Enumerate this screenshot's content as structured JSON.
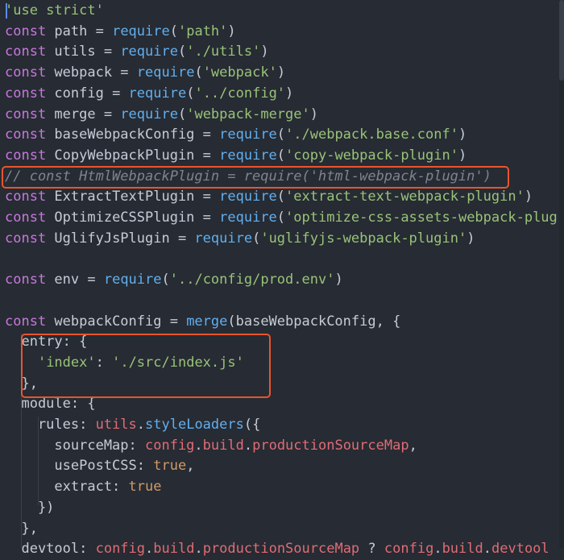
{
  "colors": {
    "background": "#272b33",
    "keyword": "#c678dd",
    "string": "#98c379",
    "function": "#61afef",
    "property": "#e06c75",
    "boolean": "#d19a66",
    "plain": "#c6ccd7",
    "comment": "#7f848e",
    "highlight_box": "#e8552e"
  },
  "code": {
    "lines": [
      [
        {
          "t": "'use strict'",
          "c": "s"
        }
      ],
      [
        {
          "t": "const",
          "c": "k"
        },
        {
          "t": " path = ",
          "c": "p"
        },
        {
          "t": "require",
          "c": "f"
        },
        {
          "t": "(",
          "c": "p"
        },
        {
          "t": "'path'",
          "c": "s"
        },
        {
          "t": ")",
          "c": "p"
        }
      ],
      [
        {
          "t": "const",
          "c": "k"
        },
        {
          "t": " utils = ",
          "c": "p"
        },
        {
          "t": "require",
          "c": "f"
        },
        {
          "t": "(",
          "c": "p"
        },
        {
          "t": "'./utils'",
          "c": "s"
        },
        {
          "t": ")",
          "c": "p"
        }
      ],
      [
        {
          "t": "const",
          "c": "k"
        },
        {
          "t": " webpack = ",
          "c": "p"
        },
        {
          "t": "require",
          "c": "f"
        },
        {
          "t": "(",
          "c": "p"
        },
        {
          "t": "'webpack'",
          "c": "s"
        },
        {
          "t": ")",
          "c": "p"
        }
      ],
      [
        {
          "t": "const",
          "c": "k"
        },
        {
          "t": " config = ",
          "c": "p"
        },
        {
          "t": "require",
          "c": "f"
        },
        {
          "t": "(",
          "c": "p"
        },
        {
          "t": "'../config'",
          "c": "s"
        },
        {
          "t": ")",
          "c": "p"
        }
      ],
      [
        {
          "t": "const",
          "c": "k"
        },
        {
          "t": " merge = ",
          "c": "p"
        },
        {
          "t": "require",
          "c": "f"
        },
        {
          "t": "(",
          "c": "p"
        },
        {
          "t": "'webpack-merge'",
          "c": "s"
        },
        {
          "t": ")",
          "c": "p"
        }
      ],
      [
        {
          "t": "const",
          "c": "k"
        },
        {
          "t": " baseWebpackConfig = ",
          "c": "p"
        },
        {
          "t": "require",
          "c": "f"
        },
        {
          "t": "(",
          "c": "p"
        },
        {
          "t": "'./webpack.base.conf'",
          "c": "s"
        },
        {
          "t": ")",
          "c": "p"
        }
      ],
      [
        {
          "t": "const",
          "c": "k"
        },
        {
          "t": " CopyWebpackPlugin = ",
          "c": "p"
        },
        {
          "t": "require",
          "c": "f"
        },
        {
          "t": "(",
          "c": "p"
        },
        {
          "t": "'copy-webpack-plugin'",
          "c": "s"
        },
        {
          "t": ")",
          "c": "p"
        }
      ],
      [
        {
          "t": "// const HtmlWebpackPlugin = require('html-webpack-plugin')",
          "c": "c"
        }
      ],
      [
        {
          "t": "const",
          "c": "k"
        },
        {
          "t": " ExtractTextPlugin = ",
          "c": "p"
        },
        {
          "t": "require",
          "c": "f"
        },
        {
          "t": "(",
          "c": "p"
        },
        {
          "t": "'extract-text-webpack-plugin'",
          "c": "s"
        },
        {
          "t": ")",
          "c": "p"
        }
      ],
      [
        {
          "t": "const",
          "c": "k"
        },
        {
          "t": " OptimizeCSSPlugin = ",
          "c": "p"
        },
        {
          "t": "require",
          "c": "f"
        },
        {
          "t": "(",
          "c": "p"
        },
        {
          "t": "'optimize-css-assets-webpack-plug",
          "c": "s"
        }
      ],
      [
        {
          "t": "const",
          "c": "k"
        },
        {
          "t": " UglifyJsPlugin = ",
          "c": "p"
        },
        {
          "t": "require",
          "c": "f"
        },
        {
          "t": "(",
          "c": "p"
        },
        {
          "t": "'uglifyjs-webpack-plugin'",
          "c": "s"
        },
        {
          "t": ")",
          "c": "p"
        }
      ],
      [],
      [
        {
          "t": "const",
          "c": "k"
        },
        {
          "t": " env = ",
          "c": "p"
        },
        {
          "t": "require",
          "c": "f"
        },
        {
          "t": "(",
          "c": "p"
        },
        {
          "t": "'../config/prod.env'",
          "c": "s"
        },
        {
          "t": ")",
          "c": "p"
        }
      ],
      [],
      [
        {
          "t": "const",
          "c": "k"
        },
        {
          "t": " webpackConfig = ",
          "c": "p"
        },
        {
          "t": "merge",
          "c": "f"
        },
        {
          "t": "(baseWebpackConfig, {",
          "c": "p"
        }
      ],
      [
        {
          "t": "  entry: {",
          "c": "p"
        }
      ],
      [
        {
          "t": "    ",
          "c": "p"
        },
        {
          "t": "'index'",
          "c": "s"
        },
        {
          "t": ": ",
          "c": "p"
        },
        {
          "t": "'./src/index.js'",
          "c": "s"
        }
      ],
      [
        {
          "t": "  },",
          "c": "p"
        }
      ],
      [
        {
          "t": "  module: {",
          "c": "p"
        }
      ],
      [
        {
          "t": "    rules: ",
          "c": "p"
        },
        {
          "t": "utils",
          "c": "r"
        },
        {
          "t": ".",
          "c": "p"
        },
        {
          "t": "styleLoaders",
          "c": "f"
        },
        {
          "t": "({",
          "c": "p"
        }
      ],
      [
        {
          "t": "      sourceMap: ",
          "c": "p"
        },
        {
          "t": "config",
          "c": "r"
        },
        {
          "t": ".",
          "c": "p"
        },
        {
          "t": "build",
          "c": "r"
        },
        {
          "t": ".",
          "c": "p"
        },
        {
          "t": "productionSourceMap",
          "c": "r"
        },
        {
          "t": ",",
          "c": "p"
        }
      ],
      [
        {
          "t": "      usePostCSS: ",
          "c": "p"
        },
        {
          "t": "true",
          "c": "b"
        },
        {
          "t": ",",
          "c": "p"
        }
      ],
      [
        {
          "t": "      extract: ",
          "c": "p"
        },
        {
          "t": "true",
          "c": "b"
        }
      ],
      [
        {
          "t": "    })",
          "c": "p"
        }
      ],
      [
        {
          "t": "  },",
          "c": "p"
        }
      ],
      [
        {
          "t": "  devtool: ",
          "c": "p"
        },
        {
          "t": "config",
          "c": "r"
        },
        {
          "t": ".",
          "c": "p"
        },
        {
          "t": "build",
          "c": "r"
        },
        {
          "t": ".",
          "c": "p"
        },
        {
          "t": "productionSourceMap",
          "c": "r"
        },
        {
          "t": " ? ",
          "c": "p"
        },
        {
          "t": "config",
          "c": "r"
        },
        {
          "t": ".",
          "c": "p"
        },
        {
          "t": "build",
          "c": "r"
        },
        {
          "t": ".",
          "c": "p"
        },
        {
          "t": "devtool",
          "c": "r"
        }
      ]
    ]
  }
}
